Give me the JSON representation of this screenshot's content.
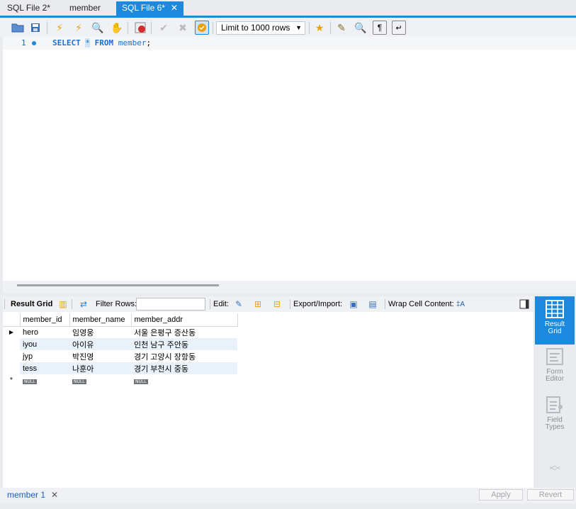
{
  "tabs": [
    {
      "label": "SQL File 2*"
    },
    {
      "label": "member"
    },
    {
      "label": "SQL File 6*",
      "active": true
    }
  ],
  "toolbar": {
    "limit_value": "Limit to 1000 rows",
    "icons": [
      "open-folder-icon",
      "save-icon",
      "execute-icon",
      "execute-current-icon",
      "explain-icon",
      "stop-icon",
      "toggle-error-icon",
      "commit-icon",
      "rollback-icon",
      "autocommit-icon",
      "add-snippet-icon",
      "beautify-icon",
      "find-icon",
      "invisible-chars-icon",
      "wrap-icon"
    ]
  },
  "editor": {
    "line_number": "1",
    "code": {
      "kw1": "SELECT",
      "star": "*",
      "kw2": "FROM",
      "table": "member",
      "end": ";"
    }
  },
  "result_toolbar": {
    "result_grid": "Result Grid",
    "filter_rows": "Filter Rows:",
    "edit": "Edit:",
    "export_import": "Export/Import:",
    "wrap_cell": "Wrap Cell Content:"
  },
  "grid": {
    "columns": [
      "member_id",
      "member_name",
      "member_addr"
    ],
    "rows": [
      [
        "hero",
        "임영웅",
        "서울 은평구 증산동"
      ],
      [
        "iyou",
        "아이유",
        "인천 남구 주안동"
      ],
      [
        "jyp",
        "박진영",
        "경기 고양시 장항동"
      ],
      [
        "tess",
        "나훈아",
        "경기 부천시 중동"
      ]
    ],
    "null_label": "NULL"
  },
  "side_panel": {
    "result_grid": "Result\nGrid",
    "form_editor": "Form\nEditor",
    "field_types": "Field\nTypes"
  },
  "bottom": {
    "result_tab": "member 1",
    "apply": "Apply",
    "revert": "Revert"
  },
  "colors": {
    "accent": "#1b89dd",
    "keyword": "#1f6fd0"
  }
}
